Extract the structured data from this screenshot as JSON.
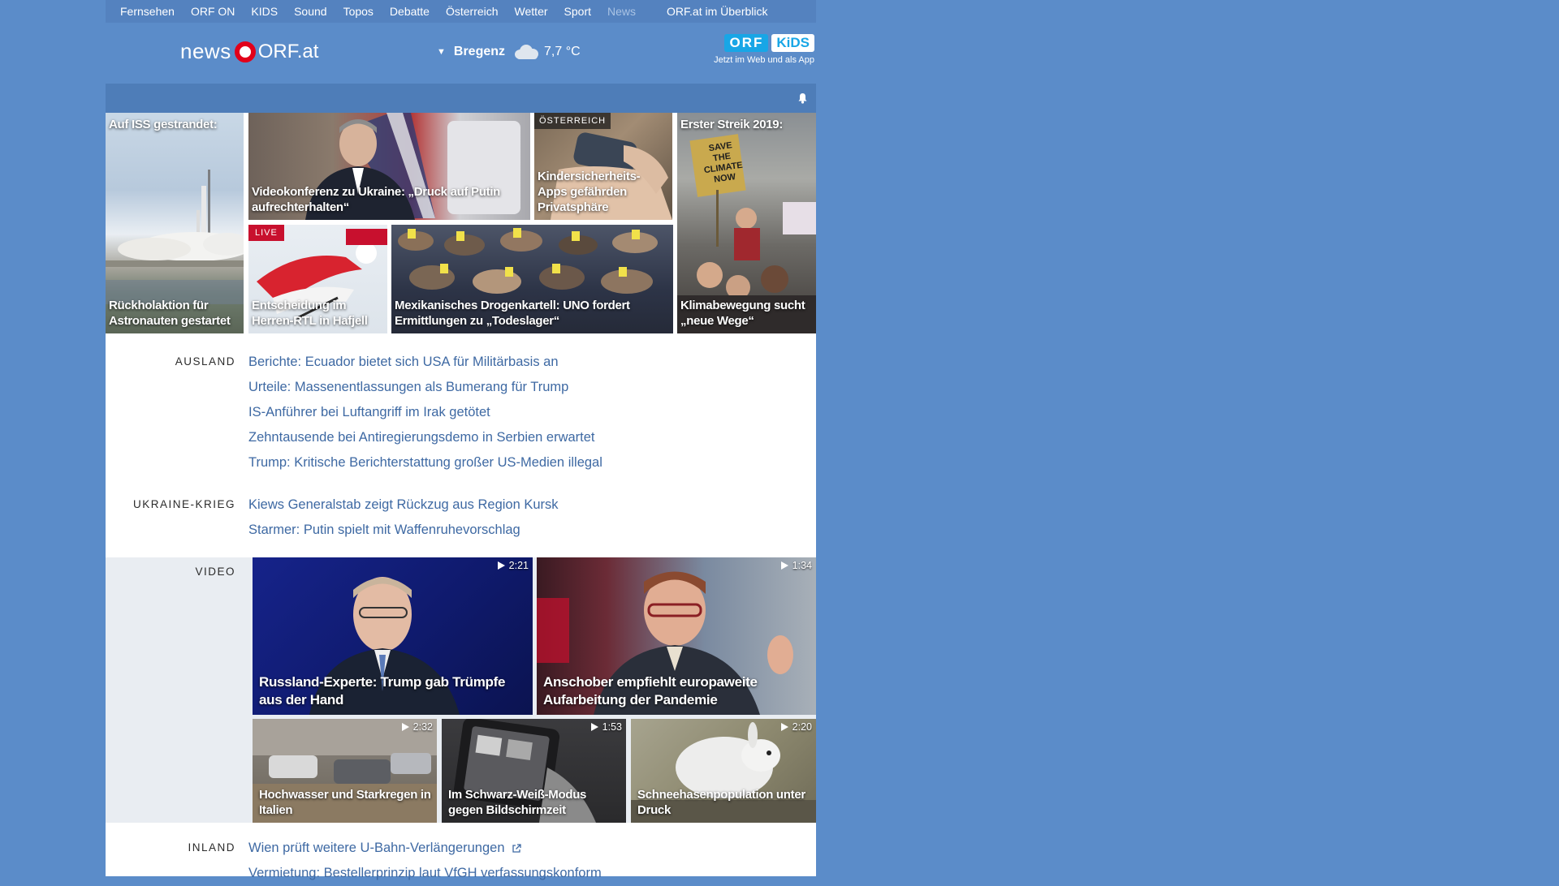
{
  "nav": {
    "items": [
      "Fernsehen",
      "ORF ON",
      "KIDS",
      "Sound",
      "Topos",
      "Debatte",
      "Österreich",
      "Wetter",
      "Sport",
      "News"
    ],
    "overview": "ORF.at im Überblick"
  },
  "header": {
    "logo_news": "news",
    "logo_orf": "ORF.at",
    "weather_city": "Bregenz",
    "weather_temp": "7,7 °C",
    "kids_orf": "ORF",
    "kids_kids": "KiDS",
    "kids_app": "Jetzt im Web und als App"
  },
  "mosaic": [
    {
      "id": "iss",
      "top": "Auf ISS gestrandet:",
      "caption": "Rückholaktion für Astronauten gestartet"
    },
    {
      "id": "ukraine",
      "caption": "Videokonferenz zu Ukraine: „Druck auf Putin aufrechterhalten“"
    },
    {
      "id": "apps",
      "tag": "ÖSTERREICH",
      "caption": "Kindersicherheits-Apps gefährden Privatsphäre"
    },
    {
      "id": "klima",
      "top": "Erster Streik 2019:",
      "caption": "Klimabewegung sucht „neue Wege“",
      "sign": "SAVE THE CLIMATE NOW"
    },
    {
      "id": "ski",
      "tag": "LIVE",
      "caption": "Entscheidung im Herren-RTL in Hafjell"
    },
    {
      "id": "kartell",
      "caption": "Mexikanisches Drogenkartell: UNO fordert Ermittlungen zu „Todeslager“"
    }
  ],
  "sections": {
    "ausland": {
      "label": "AUSLAND",
      "links": [
        "Berichte: Ecuador bietet sich USA für Militärbasis an",
        "Urteile: Massenentlassungen als Bumerang für Trump",
        "IS-Anführer bei Luftangriff im Irak getötet",
        "Zehntausende bei Antiregierungsdemo in Serbien erwartet",
        "Trump: Kritische Berichterstattung großer US-Medien illegal"
      ]
    },
    "ukraine": {
      "label": "UKRAINE-KRIEG",
      "links": [
        "Kiews Generalstab zeigt Rückzug aus Region Kursk",
        "Starmer: Putin spielt mit Waffenruhevorschlag"
      ]
    },
    "video": {
      "label": "VIDEO",
      "items": [
        {
          "duration": "2:21",
          "caption": "Russland-Experte: Trump gab Trümpfe aus der Hand"
        },
        {
          "duration": "1:34",
          "caption": "Anschober empfiehlt europaweite Aufarbeitung der Pandemie"
        },
        {
          "duration": "2:32",
          "caption": "Hochwasser und Starkregen in Italien"
        },
        {
          "duration": "1:53",
          "caption": "Im Schwarz-Weiß-Modus gegen Bildschirmzeit"
        },
        {
          "duration": "2:20",
          "caption": "Schneehasenpopulation unter Druck"
        }
      ]
    },
    "inland": {
      "label": "INLAND",
      "links": [
        "Wien prüft weitere U-Bahn-Verlängerungen",
        "Vermietung: Bestellerprinzip laut VfGH verfassungskonform"
      ]
    }
  },
  "colors": {
    "background": "#5b8cc9",
    "link": "#3e69a3",
    "orf_red": "#e2001a",
    "live_red": "#c8102e"
  }
}
